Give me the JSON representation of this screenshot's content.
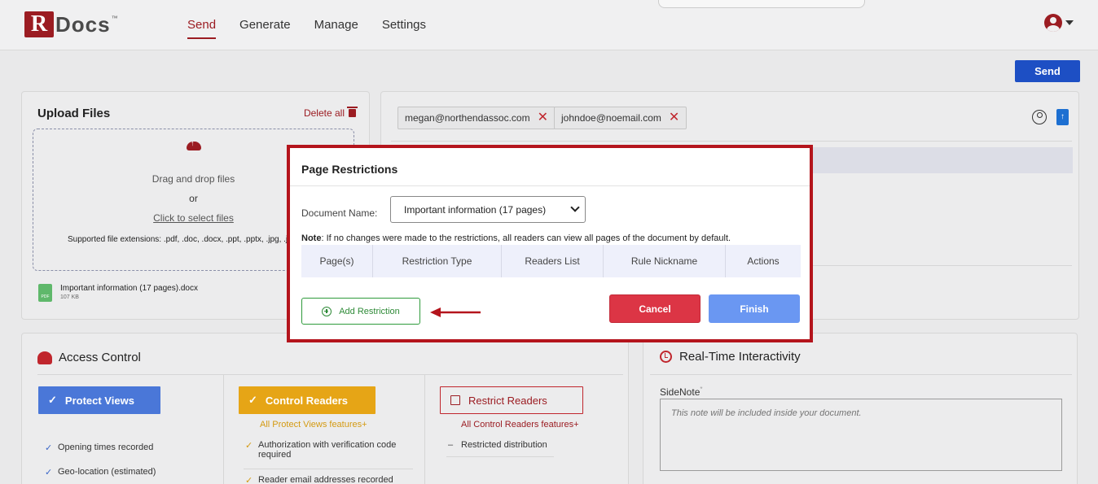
{
  "header": {
    "logo_letter": "R",
    "logo_text": "Docs",
    "logo_tm": "™",
    "nav": [
      "Send",
      "Generate",
      "Manage",
      "Settings"
    ],
    "active_nav": "Send"
  },
  "toolbar": {
    "send_label": "Send"
  },
  "upload": {
    "title": "Upload Files",
    "delete_all": "Delete all",
    "drag_text": "Drag and drop files",
    "or_text": "or",
    "click_text": "Click to select files",
    "extensions": "Supported file extensions: .pdf, .doc, .docx, .ppt, .pptx, .jpg, .jp",
    "file": {
      "name": "Important information (17 pages).docx",
      "size": "107 KB",
      "type_label": "PDF"
    }
  },
  "recipients": {
    "chips": [
      "megan@northendassoc.com",
      "johndoe@noemail.com"
    ],
    "remove_glyph": "✕"
  },
  "access_control": {
    "title": "Access Control",
    "plans": [
      {
        "label": "Protect Views",
        "selected": true
      },
      {
        "label": "Control Readers",
        "selected": true
      },
      {
        "label": "Restrict Readers",
        "selected": false
      }
    ],
    "control_sub": "All Protect Views features+",
    "restrict_sub": "All Control Readers features+",
    "protect_features": [
      "Opening times recorded",
      "Geo-location (estimated)"
    ],
    "control_features": [
      "Authorization with verification code required",
      "Reader email addresses recorded"
    ],
    "restrict_features": [
      "Restricted distribution"
    ]
  },
  "realtime": {
    "title": "Real-Time Interactivity",
    "sidenote_label": "SideNote",
    "sidenote_required": "*",
    "sidenote_placeholder": "This note will be included inside your document."
  },
  "modal": {
    "title": "Page Restrictions",
    "doc_label": "Document Name:",
    "doc_selected": "Important information (17 pages)",
    "note_bold": "Note",
    "note_text": ": If no changes were made to the restrictions, all readers can view all pages of the document by default.",
    "columns": [
      "Page(s)",
      "Restriction Type",
      "Readers List",
      "Rule Nickname",
      "Actions"
    ],
    "add_label": "Add Restriction",
    "cancel_label": "Cancel",
    "finish_label": "Finish"
  },
  "colors": {
    "brand": "#9b1c22",
    "primary": "#1d4fc4",
    "highlight_frame": "#b4141c",
    "cancel": "#dc3545",
    "finish": "#6a97f2",
    "add": "#2e8a37"
  }
}
